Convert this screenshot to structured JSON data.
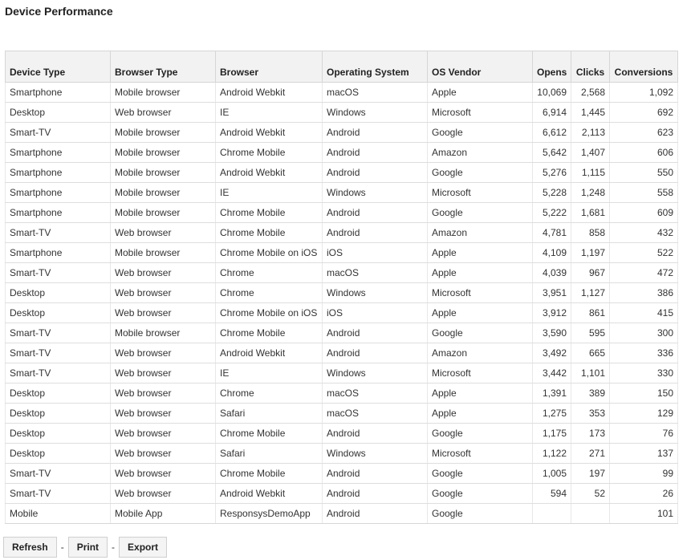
{
  "title": "Device Performance",
  "columns": [
    "Device Type",
    "Browser Type",
    "Browser",
    "Operating System",
    "OS Vendor",
    "Opens",
    "Clicks",
    "Conversions"
  ],
  "rows": [
    [
      "Smartphone",
      "Mobile browser",
      "Android Webkit",
      "macOS",
      "Apple",
      "10,069",
      "2,568",
      "1,092"
    ],
    [
      "Desktop",
      "Web browser",
      "IE",
      "Windows",
      "Microsoft",
      "6,914",
      "1,445",
      "692"
    ],
    [
      "Smart-TV",
      "Mobile browser",
      "Android Webkit",
      "Android",
      "Google",
      "6,612",
      "2,113",
      "623"
    ],
    [
      "Smartphone",
      "Mobile browser",
      "Chrome Mobile",
      "Android",
      "Amazon",
      "5,642",
      "1,407",
      "606"
    ],
    [
      "Smartphone",
      "Mobile browser",
      "Android Webkit",
      "Android",
      "Google",
      "5,276",
      "1,115",
      "550"
    ],
    [
      "Smartphone",
      "Mobile browser",
      "IE",
      "Windows",
      "Microsoft",
      "5,228",
      "1,248",
      "558"
    ],
    [
      "Smartphone",
      "Mobile browser",
      "Chrome Mobile",
      "Android",
      "Google",
      "5,222",
      "1,681",
      "609"
    ],
    [
      "Smart-TV",
      "Web browser",
      "Chrome Mobile",
      "Android",
      "Amazon",
      "4,781",
      "858",
      "432"
    ],
    [
      "Smartphone",
      "Mobile browser",
      "Chrome Mobile on iOS",
      "iOS",
      "Apple",
      "4,109",
      "1,197",
      "522"
    ],
    [
      "Smart-TV",
      "Web browser",
      "Chrome",
      "macOS",
      "Apple",
      "4,039",
      "967",
      "472"
    ],
    [
      "Desktop",
      "Web browser",
      "Chrome",
      "Windows",
      "Microsoft",
      "3,951",
      "1,127",
      "386"
    ],
    [
      "Desktop",
      "Web browser",
      "Chrome Mobile on iOS",
      "iOS",
      "Apple",
      "3,912",
      "861",
      "415"
    ],
    [
      "Smart-TV",
      "Mobile browser",
      "Chrome Mobile",
      "Android",
      "Google",
      "3,590",
      "595",
      "300"
    ],
    [
      "Smart-TV",
      "Web browser",
      "Android Webkit",
      "Android",
      "Amazon",
      "3,492",
      "665",
      "336"
    ],
    [
      "Smart-TV",
      "Web browser",
      "IE",
      "Windows",
      "Microsoft",
      "3,442",
      "1,101",
      "330"
    ],
    [
      "Desktop",
      "Web browser",
      "Chrome",
      "macOS",
      "Apple",
      "1,391",
      "389",
      "150"
    ],
    [
      "Desktop",
      "Web browser",
      "Safari",
      "macOS",
      "Apple",
      "1,275",
      "353",
      "129"
    ],
    [
      "Desktop",
      "Web browser",
      "Chrome Mobile",
      "Android",
      "Google",
      "1,175",
      "173",
      "76"
    ],
    [
      "Desktop",
      "Web browser",
      "Safari",
      "Windows",
      "Microsoft",
      "1,122",
      "271",
      "137"
    ],
    [
      "Smart-TV",
      "Web browser",
      "Chrome Mobile",
      "Android",
      "Google",
      "1,005",
      "197",
      "99"
    ],
    [
      "Smart-TV",
      "Web browser",
      "Android Webkit",
      "Android",
      "Google",
      "594",
      "52",
      "26"
    ],
    [
      "Mobile",
      "Mobile App",
      "ResponsysDemoApp",
      "Android",
      "Google",
      "",
      "",
      "101"
    ]
  ],
  "actions": {
    "refresh_label": "Refresh",
    "print_label": "Print",
    "export_label": "Export",
    "separator": "-"
  }
}
